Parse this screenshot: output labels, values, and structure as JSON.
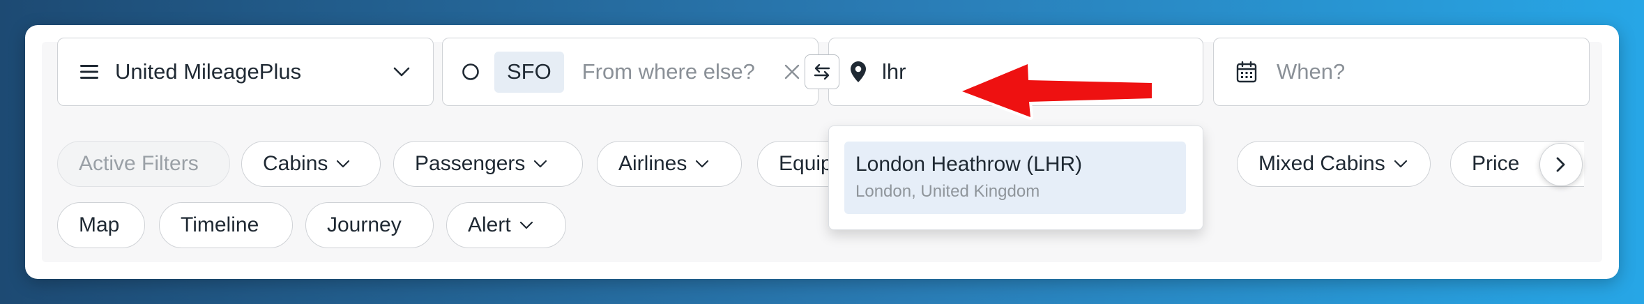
{
  "search": {
    "program": {
      "label": "United MileagePlus",
      "icon": "menu-icon"
    },
    "origin": {
      "chip": "SFO",
      "placeholder": "From where else?"
    },
    "destination": {
      "value": "lhr"
    },
    "date": {
      "placeholder": "When?"
    }
  },
  "filters": {
    "row1": [
      {
        "label": "Active Filters"
      },
      {
        "label": "Cabins"
      },
      {
        "label": "Passengers"
      },
      {
        "label": "Airlines"
      },
      {
        "label": "Equip"
      },
      {
        "label": "Mixed Cabins"
      },
      {
        "label": "Price"
      }
    ],
    "row2": [
      {
        "label": "Map"
      },
      {
        "label": "Timeline"
      },
      {
        "label": "Journey"
      },
      {
        "label": "Alert"
      }
    ]
  },
  "autocomplete": {
    "options": [
      {
        "name": "London Heathrow (LHR)",
        "location": "London, United Kingdom"
      }
    ]
  },
  "colors": {
    "annotation_arrow": "#ee1111",
    "chip_bg": "#e6edf5",
    "option_highlight": "#e6eef8"
  }
}
